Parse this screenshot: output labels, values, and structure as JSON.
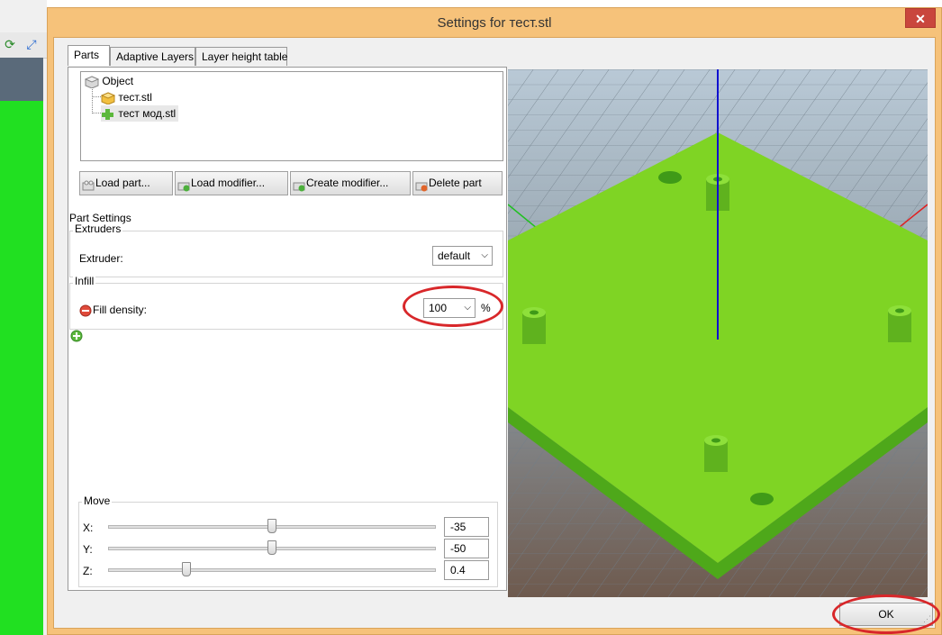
{
  "window": {
    "title": "Settings for тест.stl",
    "close_label": "✕"
  },
  "tabs": [
    {
      "label": "Parts",
      "active": true
    },
    {
      "label": "Adaptive Layers",
      "active": false
    },
    {
      "label": "Layer height table",
      "active": false
    }
  ],
  "tree": {
    "root": "Object",
    "children": [
      "тест.stl",
      "тест мод.stl"
    ]
  },
  "buttons": {
    "load_part": "Load part...",
    "load_modifier": "Load modifier...",
    "create_modifier": "Create modifier...",
    "delete_part": "Delete part"
  },
  "part_settings": {
    "title": "Part Settings",
    "extruders": {
      "title": "Extruders",
      "label": "Extruder:",
      "value": "default"
    },
    "infill": {
      "title": "Infill",
      "fill_density_label": "Fill density:",
      "fill_density_value": "100",
      "unit": "%"
    }
  },
  "move": {
    "title": "Move",
    "axes": [
      {
        "label": "X:",
        "value": "-35",
        "position": 0.5
      },
      {
        "label": "Y:",
        "value": "-50",
        "position": 0.5
      },
      {
        "label": "Z:",
        "value": "0.4",
        "position": 0.24
      }
    ]
  },
  "ok_label": "OK",
  "colors": {
    "model_green": "#7fd424",
    "axis_blue": "#1010d0",
    "axis_red": "#e02020",
    "axis_green": "#20c020",
    "highlight_red": "#d8272a"
  }
}
